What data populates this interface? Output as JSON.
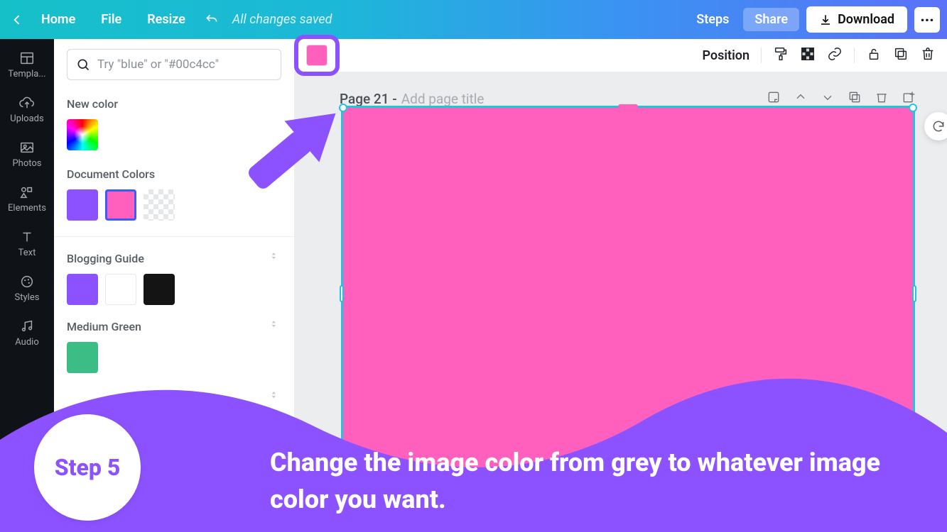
{
  "topbar": {
    "home": "Home",
    "file": "File",
    "resize": "Resize",
    "save_status": "All changes saved",
    "steps": "Steps",
    "share": "Share",
    "download": "Download"
  },
  "nav": {
    "templates": "Templa...",
    "uploads": "Uploads",
    "photos": "Photos",
    "elements": "Elements",
    "text": "Text",
    "styles": "Styles",
    "audio": "Audio"
  },
  "panel": {
    "search_placeholder": "Try \"blue\" or \"#00c4cc\"",
    "new_color": "New color",
    "document_colors": "Document Colors",
    "blogging_guide": "Blogging Guide",
    "medium_green": "Medium Green",
    "colors": {
      "doc1": "#8c52ff",
      "doc2": "#ff5fbd",
      "bg_purple": "#8c52ff",
      "bg_white": "#ffffff",
      "bg_black": "#141414",
      "medium_green": "#3dbd86"
    }
  },
  "editbar": {
    "position": "Position",
    "current_color": "#ff5fbd"
  },
  "page": {
    "label": "Page 21 -",
    "subtitle": "Add page title"
  },
  "tutorial": {
    "step_label": "Step 5",
    "text": "Change the image color from grey to whatever image color you want."
  }
}
